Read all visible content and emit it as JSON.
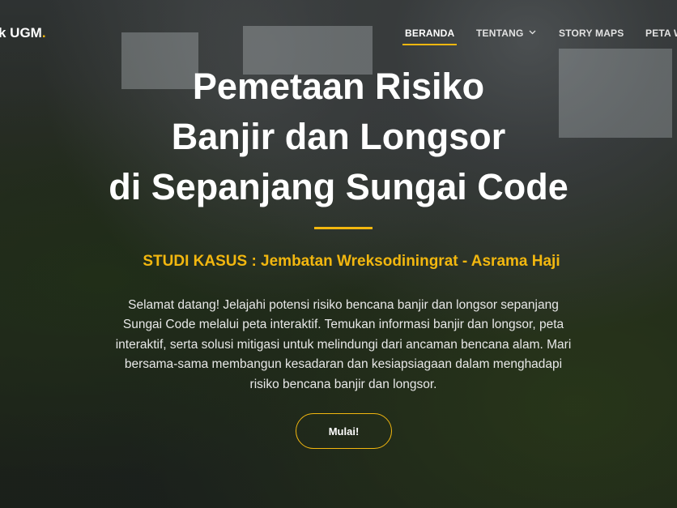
{
  "brand": {
    "text": "k UGM",
    "dot": "."
  },
  "nav": {
    "items": [
      {
        "label": "BERANDA",
        "active": true
      },
      {
        "label": "TENTANG",
        "dropdown": true
      },
      {
        "label": "STORY MAPS"
      },
      {
        "label": "PETA W"
      }
    ]
  },
  "hero": {
    "title_lines": [
      "Pemetaan Risiko",
      "Banjir dan Longsor",
      "di Sepanjang Sungai Code"
    ],
    "subtitle": "STUDI KASUS : Jembatan Wreksodiningrat - Asrama Haji",
    "intro": "Selamat datang! Jelajahi potensi risiko bencana banjir dan longsor sepanjang Sungai Code melalui peta interaktif. Temukan informasi banjir dan longsor, peta interaktif, serta solusi mitigasi untuk melindungi dari ancaman bencana alam. Mari bersama-sama membangun kesadaran dan kesiapsiagaan dalam menghadapi risiko bencana banjir dan longsor.",
    "cta_label": "Mulai!"
  },
  "colors": {
    "accent": "#f2b70f",
    "text": "#ffffff"
  },
  "icons": {
    "dropdown": "chevron-down-icon"
  }
}
